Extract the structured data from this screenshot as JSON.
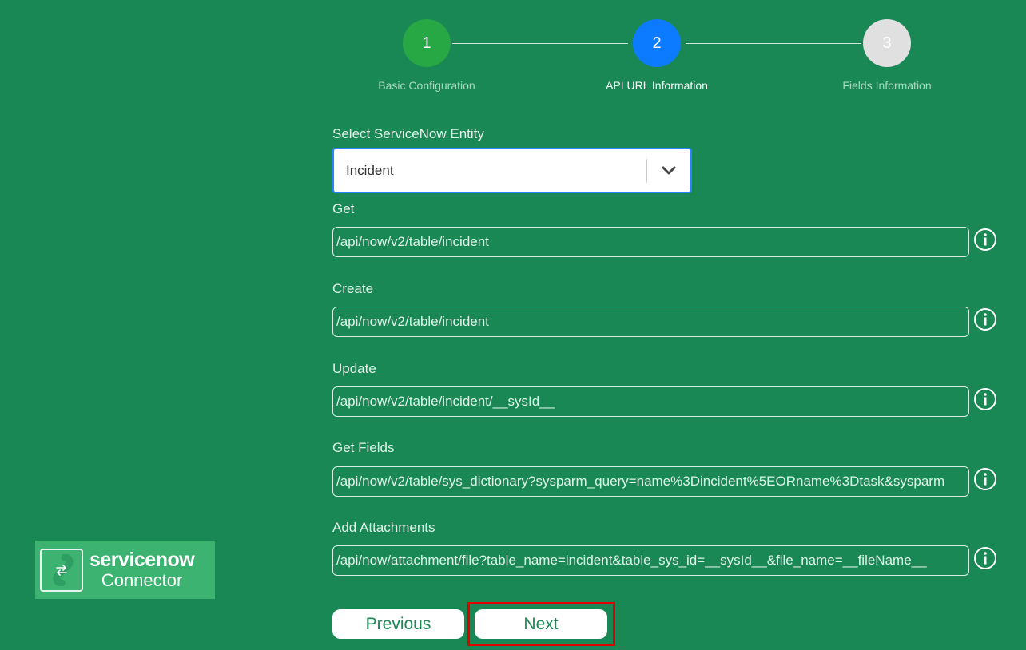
{
  "stepper": {
    "steps": [
      {
        "number": "1",
        "label": "Basic Configuration",
        "state": "completed",
        "color": "#28a745"
      },
      {
        "number": "2",
        "label": "API URL Information",
        "state": "active",
        "color": "#0d7bff"
      },
      {
        "number": "3",
        "label": "Fields Information",
        "state": "pending",
        "color": "#e0e0e0"
      }
    ]
  },
  "entity": {
    "label": "Select ServiceNow Entity",
    "selected": "Incident"
  },
  "fields": [
    {
      "label": "Get",
      "value": "/api/now/v2/table/incident"
    },
    {
      "label": "Create",
      "value": "/api/now/v2/table/incident"
    },
    {
      "label": "Update",
      "value": "/api/now/v2/table/incident/__sysId__"
    },
    {
      "label": "Get Fields",
      "value": "/api/now/v2/table/sys_dictionary?sysparm_query=name%3Dincident%5EORname%3Dtask&sysparm"
    },
    {
      "label": "Add Attachments",
      "value": "/api/now/attachment/file?table_name=incident&table_sys_id=__sysId__&file_name=__fileName__"
    }
  ],
  "logo": {
    "brand": "servicenow",
    "sub": "Connector"
  },
  "buttons": {
    "previous": "Previous",
    "next": "Next"
  },
  "colors": {
    "background": "#1a8855",
    "highlight": "#e00000",
    "logo_bg": "#3cb371"
  }
}
